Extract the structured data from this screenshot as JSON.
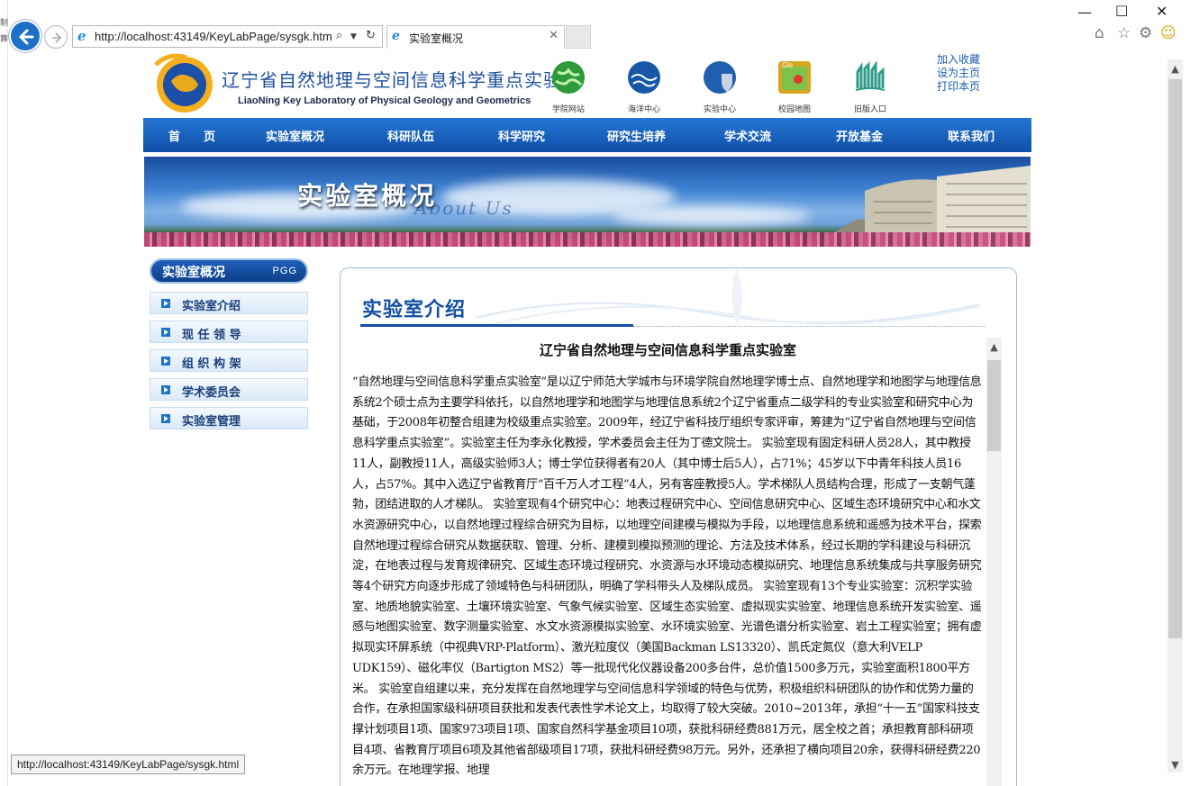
{
  "browser": {
    "url": "http://localhost:43149/KeyLabPage/sysgk.htm",
    "tab_title": "实验室概况",
    "status_url": "http://localhost:43149/KeyLabPage/sysgk.html"
  },
  "header": {
    "title": "辽宁省自然地理与空间信息科学重点实验室",
    "subtitle": "LiaoNing Key Laboratory of Physical Geology and Geometrics",
    "quick_links": [
      {
        "label": "学院网站",
        "icon": "globe-icon"
      },
      {
        "label": "海洋中心",
        "icon": "ocean-icon"
      },
      {
        "label": "实验中心",
        "icon": "shield-globe-icon"
      },
      {
        "label": "校园地图",
        "icon": "gis-map-icon"
      },
      {
        "label": "旧版入口",
        "icon": "old-version-icon"
      }
    ],
    "utility": [
      "加入收藏",
      "设为主页",
      "打印本页"
    ]
  },
  "nav": [
    "首　　页",
    "实验室概况",
    "科研队伍",
    "科学研究",
    "研究生培养",
    "学术交流",
    "开放基金",
    "联系我们"
  ],
  "banner": {
    "title": "实验室概况",
    "subtitle": "About Us"
  },
  "sidebar": {
    "heading": "实验室概况",
    "heading_tag": "PGG",
    "items": [
      "实验室介绍",
      "现 任 领 导",
      "组 织 构 架",
      "学术委员会",
      "实验室管理"
    ]
  },
  "content": {
    "section_title": "实验室介绍",
    "article_title": "辽宁省自然地理与空间信息科学重点实验室",
    "article_body": "“自然地理与空间信息科学重点实验室”是以辽宁师范大学城市与环境学院自然地理学博士点、自然地理学和地图学与地理信息系统2个硕士点为主要学科依托，以自然地理学和地图学与地理信息系统2个辽宁省重点二级学科的专业实验室和研究中心为基础，于2008年初整合组建为校级重点实验室。2009年，经辽宁省科技厅组织专家评审，筹建为“辽宁省自然地理与空间信息科学重点实验室”。实验室主任为李永化教授，学术委员会主任为丁德文院士。 实验室现有固定科研人员28人，其中教授11人，副教授11人，高级实验师3人；博士学位获得者有20人（其中博士后5人），占71%；45岁以下中青年科技人员16人，占57%。其中入选辽宁省教育厅“百千万人才工程”4人，另有客座教授5人。学术梯队人员结构合理，形成了一支朝气蓬勃，团结进取的人才梯队。 实验室现有4个研究中心：地表过程研究中心、空间信息研究中心、区域生态环境研究中心和水文水资源研究中心，以自然地理过程综合研究为目标，以地理空间建模与模拟为手段，以地理信息系统和遥感为技术平台，探索自然地理过程综合研究从数据获取、管理、分析、建模到模拟预测的理论、方法及技术体系，经过长期的学科建设与科研沉淀，在地表过程与发育规律研究、区域生态环境过程研究、水资源与水环境动态模拟研究、地理信息系统集成与共享服务研究等4个研究方向逐步形成了领域特色与科研团队，明确了学科带头人及梯队成员。 实验室现有13个专业实验室：沉积学实验室、地质地貌实验室、土壤环境实验室、气象气候实验室、区域生态实验室、虚拟现实实验室、地理信息系统开发实验室、遥感与地图实验室、数字测量实验室、水文水资源模拟实验室、水环境实验室、光谱色谱分析实验室、岩土工程实验室；拥有虚拟现实环屏系统（中视典VRP-Platform）、激光粒度仪（美国Backman LS13320）、凯氏定氮仪（意大利VELP UDK159）、磁化率仪（Bartigton MS2）等一批现代化仪器设备200多台件，总价值1500多万元，实验室面积1800平方米。 实验室自组建以来，充分发挥在自然地理学与空间信息科学领域的特色与优势，积极组织科研团队的协作和优势力量的合作，在承担国家级科研项目获批和发表代表性学术论文上，均取得了较大突破。2010~2013年，承担“十一五”国家科技支撑计划项目1项、国家973项目1项、国家自然科学基金项目10项，获批科研经费881万元，居全校之首；承担教育部科研项目4项、省教育厅项目6项及其他省部级项目17项，获批科研经费98万元。另外，还承担了横向项目20余，获得科研经费220余万元。在地理学报、地理"
  },
  "colors": {
    "nav_bg": "#1656b0",
    "title_blue": "#1250a3",
    "sidebar_text": "#1a3f7a"
  }
}
